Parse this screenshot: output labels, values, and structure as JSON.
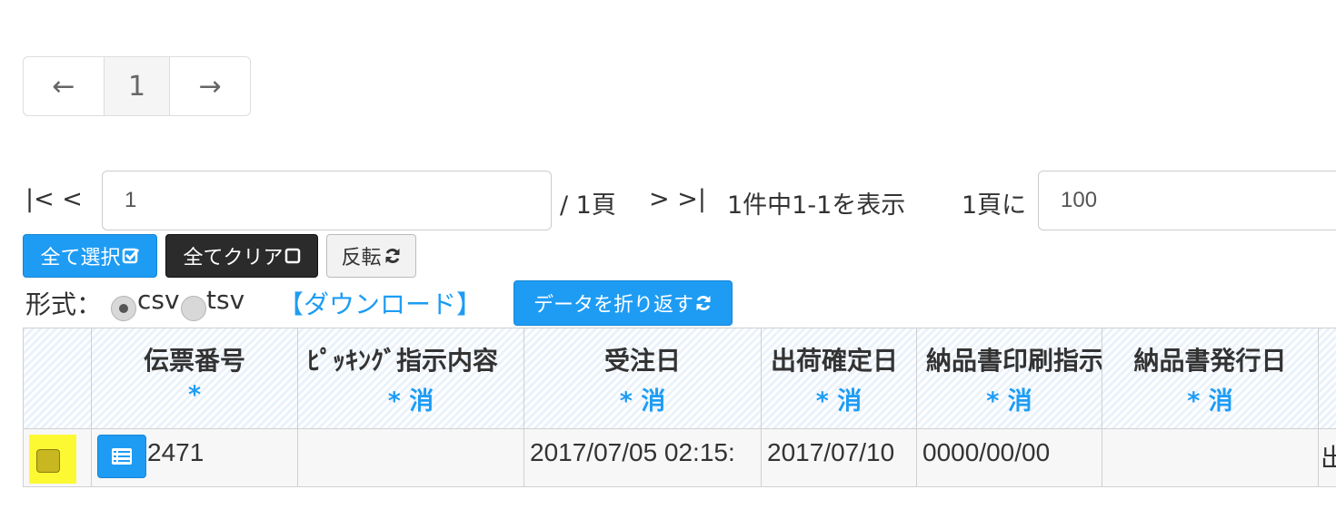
{
  "pager": {
    "prev": "←",
    "current": "1",
    "next": "→"
  },
  "paging": {
    "first": "|< <",
    "page_value": "1",
    "total_pages": "/ 1頁",
    "last": "> >|",
    "summary": "1件中1-1を表示",
    "per_page_label": "1頁に",
    "per_page_value": "100"
  },
  "buttons": {
    "select_all": "全て選択",
    "clear_all": "全てクリア",
    "invert": "反転",
    "wrap_data": "データを折り返す"
  },
  "format": {
    "label": "形式：",
    "csv": "csv",
    "tsv": "tsv",
    "selected": "csv",
    "download": "【ダウンロード】"
  },
  "table": {
    "columns": [
      {
        "title": "",
        "sub": ""
      },
      {
        "title": "伝票番号",
        "sub": "*"
      },
      {
        "title": "ﾋﾟｯｷﾝｸﾞ指示内容",
        "sub": "* 消"
      },
      {
        "title": "受注日",
        "sub": "* 消"
      },
      {
        "title": "出荷確定日",
        "sub": "* 消"
      },
      {
        "title": "納品書印刷指示",
        "sub": "* 消"
      },
      {
        "title": "納品書発行日",
        "sub": "* 消"
      },
      {
        "title": "",
        "sub": ""
      }
    ],
    "rows": [
      {
        "checked": false,
        "slip_no": "2471",
        "picking": "",
        "order_date": "2017/07/05 02:15:",
        "ship_date": "2017/07/10",
        "print_flag": "0000/00/00",
        "issue_date": "",
        "extra": "出"
      }
    ]
  },
  "colors": {
    "accent": "#1e9cf4",
    "dark_button": "#2b2b2b",
    "highlight": "#fcf932"
  },
  "icons": [
    "checkbox-checked-icon",
    "checkbox-empty-icon",
    "refresh-icon",
    "document-list-icon"
  ]
}
